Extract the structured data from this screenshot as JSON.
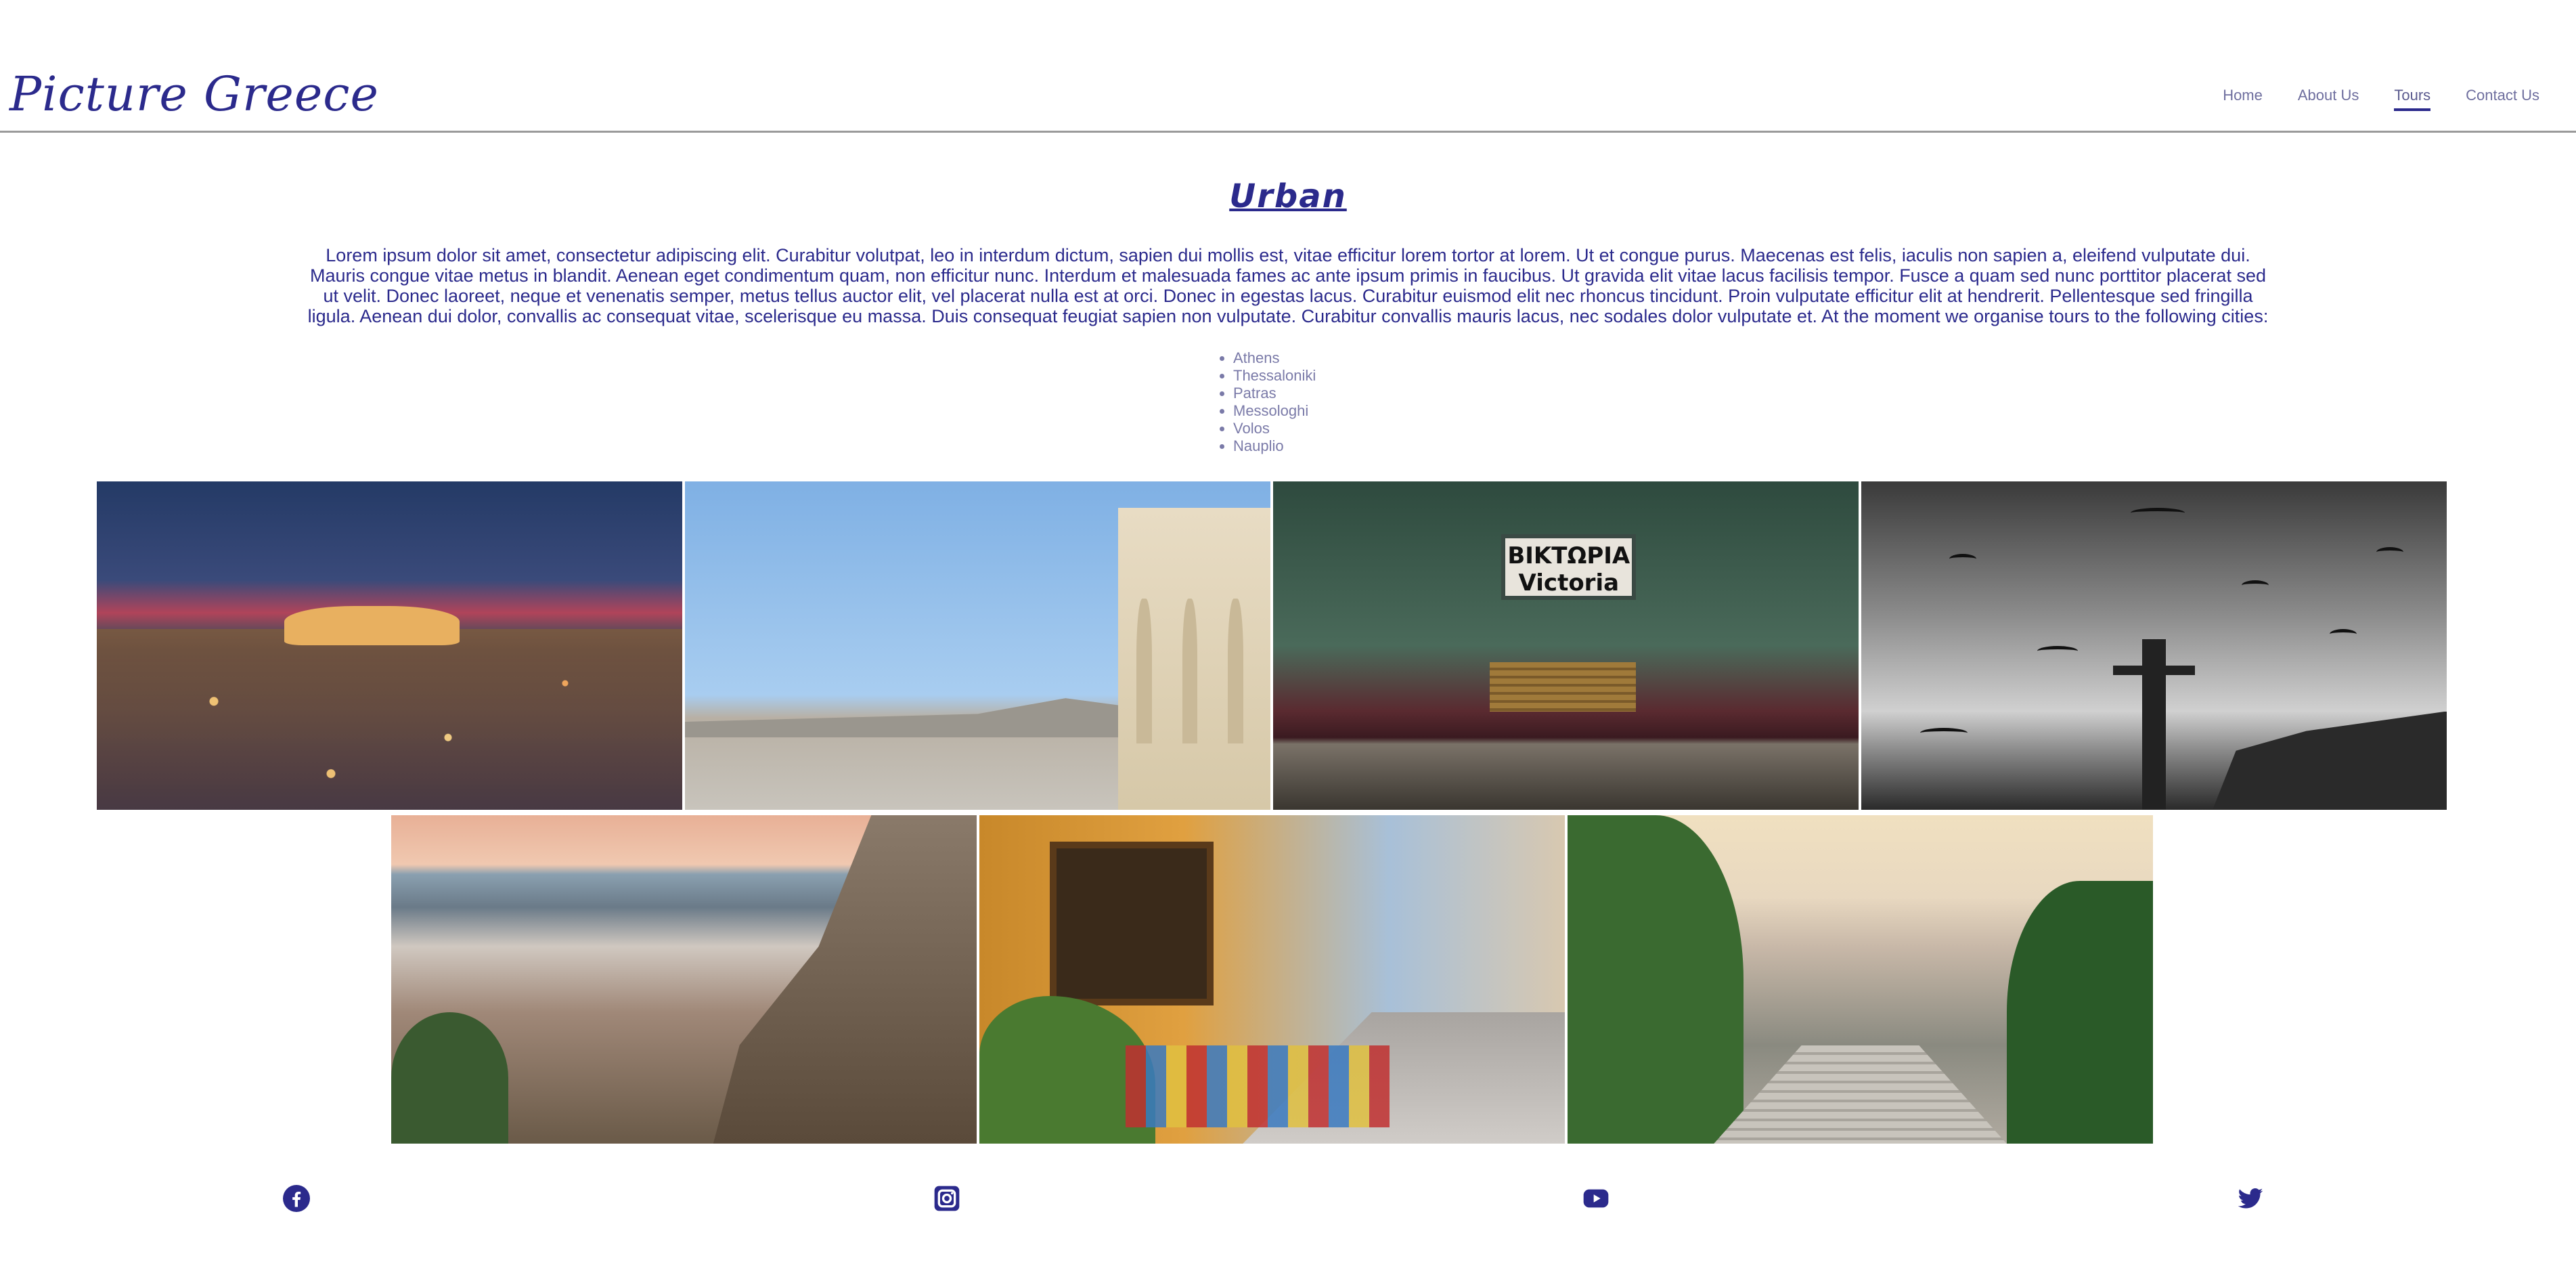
{
  "site": {
    "logo": "Picture Greece"
  },
  "nav": {
    "items": [
      {
        "label": "Home",
        "active": false
      },
      {
        "label": "About Us",
        "active": false
      },
      {
        "label": "Tours",
        "active": true
      },
      {
        "label": "Contact Us",
        "active": false
      }
    ]
  },
  "main": {
    "title": "Urban",
    "intro": "Lorem ipsum dolor sit amet, consectetur adipiscing elit. Curabitur volutpat, leo in interdum dictum, sapien dui mollis est, vitae efficitur lorem tortor at lorem. Ut et congue purus. Maecenas est felis, iaculis non sapien a, eleifend vulputate dui. Mauris congue vitae metus in blandit. Aenean eget condimentum quam, non efficitur nunc. Interdum et malesuada fames ac ante ipsum primis in faucibus. Ut gravida elit vitae lacus facilisis tempor. Fusce a quam sed nunc porttitor placerat sed ut velit. Donec laoreet, neque et venenatis semper, metus tellus auctor elit, vel placerat nulla est at orci. Donec in egestas lacus. Curabitur euismod elit nec rhoncus tincidunt. Proin vulputate efficitur elit at hendrerit. Pellentesque sed fringilla ligula. Aenean dui dolor, convallis ac consequat vitae, scelerisque eu massa. Duis consequat feugiat sapien non vulputate. Curabitur convallis mauris lacus, nec sodales dolor vulputate et. At the moment we organise tours to the following cities:",
    "cities": [
      "Athens",
      "Thessaloniki",
      "Patras",
      "Messologhi",
      "Volos",
      "Nauplio"
    ],
    "metro_sign": {
      "line1": "ΒΙΚΤΩΡΙΑ",
      "line2": "Victoria"
    }
  },
  "footer": {
    "icons": [
      "facebook-icon",
      "instagram-icon",
      "youtube-icon",
      "twitter-icon"
    ]
  },
  "colors": {
    "brand": "#2b2a8c",
    "nav_text": "#6e6e9e",
    "divider": "#9a9a9a"
  }
}
